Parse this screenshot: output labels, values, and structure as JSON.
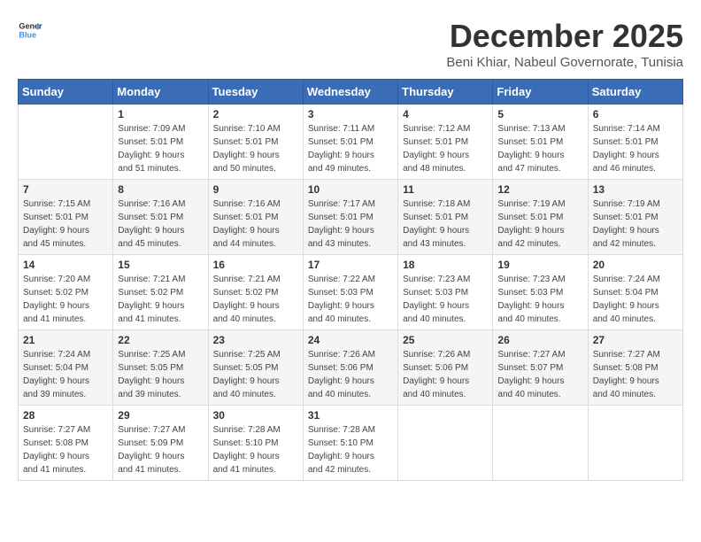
{
  "header": {
    "logo_general": "General",
    "logo_blue": "Blue",
    "month_title": "December 2025",
    "subtitle": "Beni Khiar, Nabeul Governorate, Tunisia"
  },
  "calendar": {
    "days_of_week": [
      "Sunday",
      "Monday",
      "Tuesday",
      "Wednesday",
      "Thursday",
      "Friday",
      "Saturday"
    ],
    "weeks": [
      [
        {
          "day": "",
          "info": ""
        },
        {
          "day": "1",
          "info": "Sunrise: 7:09 AM\nSunset: 5:01 PM\nDaylight: 9 hours\nand 51 minutes."
        },
        {
          "day": "2",
          "info": "Sunrise: 7:10 AM\nSunset: 5:01 PM\nDaylight: 9 hours\nand 50 minutes."
        },
        {
          "day": "3",
          "info": "Sunrise: 7:11 AM\nSunset: 5:01 PM\nDaylight: 9 hours\nand 49 minutes."
        },
        {
          "day": "4",
          "info": "Sunrise: 7:12 AM\nSunset: 5:01 PM\nDaylight: 9 hours\nand 48 minutes."
        },
        {
          "day": "5",
          "info": "Sunrise: 7:13 AM\nSunset: 5:01 PM\nDaylight: 9 hours\nand 47 minutes."
        },
        {
          "day": "6",
          "info": "Sunrise: 7:14 AM\nSunset: 5:01 PM\nDaylight: 9 hours\nand 46 minutes."
        }
      ],
      [
        {
          "day": "7",
          "info": "Sunrise: 7:15 AM\nSunset: 5:01 PM\nDaylight: 9 hours\nand 45 minutes."
        },
        {
          "day": "8",
          "info": "Sunrise: 7:16 AM\nSunset: 5:01 PM\nDaylight: 9 hours\nand 45 minutes."
        },
        {
          "day": "9",
          "info": "Sunrise: 7:16 AM\nSunset: 5:01 PM\nDaylight: 9 hours\nand 44 minutes."
        },
        {
          "day": "10",
          "info": "Sunrise: 7:17 AM\nSunset: 5:01 PM\nDaylight: 9 hours\nand 43 minutes."
        },
        {
          "day": "11",
          "info": "Sunrise: 7:18 AM\nSunset: 5:01 PM\nDaylight: 9 hours\nand 43 minutes."
        },
        {
          "day": "12",
          "info": "Sunrise: 7:19 AM\nSunset: 5:01 PM\nDaylight: 9 hours\nand 42 minutes."
        },
        {
          "day": "13",
          "info": "Sunrise: 7:19 AM\nSunset: 5:01 PM\nDaylight: 9 hours\nand 42 minutes."
        }
      ],
      [
        {
          "day": "14",
          "info": "Sunrise: 7:20 AM\nSunset: 5:02 PM\nDaylight: 9 hours\nand 41 minutes."
        },
        {
          "day": "15",
          "info": "Sunrise: 7:21 AM\nSunset: 5:02 PM\nDaylight: 9 hours\nand 41 minutes."
        },
        {
          "day": "16",
          "info": "Sunrise: 7:21 AM\nSunset: 5:02 PM\nDaylight: 9 hours\nand 40 minutes."
        },
        {
          "day": "17",
          "info": "Sunrise: 7:22 AM\nSunset: 5:03 PM\nDaylight: 9 hours\nand 40 minutes."
        },
        {
          "day": "18",
          "info": "Sunrise: 7:23 AM\nSunset: 5:03 PM\nDaylight: 9 hours\nand 40 minutes."
        },
        {
          "day": "19",
          "info": "Sunrise: 7:23 AM\nSunset: 5:03 PM\nDaylight: 9 hours\nand 40 minutes."
        },
        {
          "day": "20",
          "info": "Sunrise: 7:24 AM\nSunset: 5:04 PM\nDaylight: 9 hours\nand 40 minutes."
        }
      ],
      [
        {
          "day": "21",
          "info": "Sunrise: 7:24 AM\nSunset: 5:04 PM\nDaylight: 9 hours\nand 39 minutes."
        },
        {
          "day": "22",
          "info": "Sunrise: 7:25 AM\nSunset: 5:05 PM\nDaylight: 9 hours\nand 39 minutes."
        },
        {
          "day": "23",
          "info": "Sunrise: 7:25 AM\nSunset: 5:05 PM\nDaylight: 9 hours\nand 40 minutes."
        },
        {
          "day": "24",
          "info": "Sunrise: 7:26 AM\nSunset: 5:06 PM\nDaylight: 9 hours\nand 40 minutes."
        },
        {
          "day": "25",
          "info": "Sunrise: 7:26 AM\nSunset: 5:06 PM\nDaylight: 9 hours\nand 40 minutes."
        },
        {
          "day": "26",
          "info": "Sunrise: 7:27 AM\nSunset: 5:07 PM\nDaylight: 9 hours\nand 40 minutes."
        },
        {
          "day": "27",
          "info": "Sunrise: 7:27 AM\nSunset: 5:08 PM\nDaylight: 9 hours\nand 40 minutes."
        }
      ],
      [
        {
          "day": "28",
          "info": "Sunrise: 7:27 AM\nSunset: 5:08 PM\nDaylight: 9 hours\nand 41 minutes."
        },
        {
          "day": "29",
          "info": "Sunrise: 7:27 AM\nSunset: 5:09 PM\nDaylight: 9 hours\nand 41 minutes."
        },
        {
          "day": "30",
          "info": "Sunrise: 7:28 AM\nSunset: 5:10 PM\nDaylight: 9 hours\nand 41 minutes."
        },
        {
          "day": "31",
          "info": "Sunrise: 7:28 AM\nSunset: 5:10 PM\nDaylight: 9 hours\nand 42 minutes."
        },
        {
          "day": "",
          "info": ""
        },
        {
          "day": "",
          "info": ""
        },
        {
          "day": "",
          "info": ""
        }
      ]
    ]
  }
}
